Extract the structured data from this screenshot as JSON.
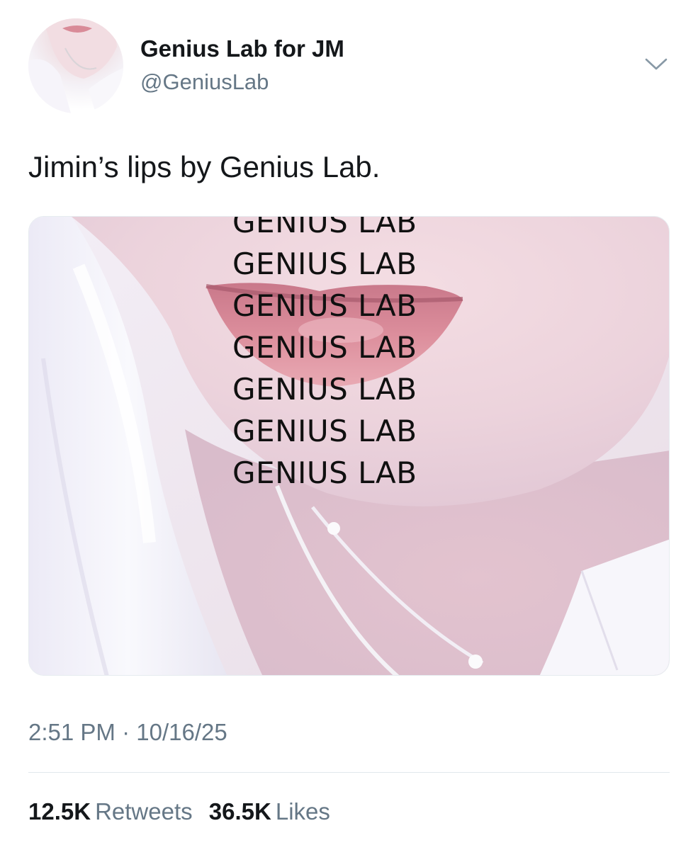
{
  "tweet": {
    "author": {
      "display_name": "Genius Lab for JM",
      "handle": "@GeniusLab",
      "avatar": "profile-photo"
    },
    "menu_icon": "chevron-down-icon",
    "text": "Jimin’s lips by Genius Lab.",
    "media": {
      "watermark_lines": [
        "GENIUS LAB",
        "GENIUS LAB",
        "GENIUS LAB",
        "GENIUS LAB",
        "GENIUS LAB",
        "GENIUS LAB",
        "GENIUS LAB"
      ]
    },
    "time": "2:51 PM",
    "date": "10/16/25",
    "separator": "·",
    "stats": {
      "retweets_count": "12.5K",
      "retweets_label": "Retweets",
      "likes_count": "36.5K",
      "likes_label": "Likes"
    }
  },
  "colors": {
    "text_primary": "#14171a",
    "text_secondary": "#657786",
    "divider": "#e1e8ed"
  }
}
